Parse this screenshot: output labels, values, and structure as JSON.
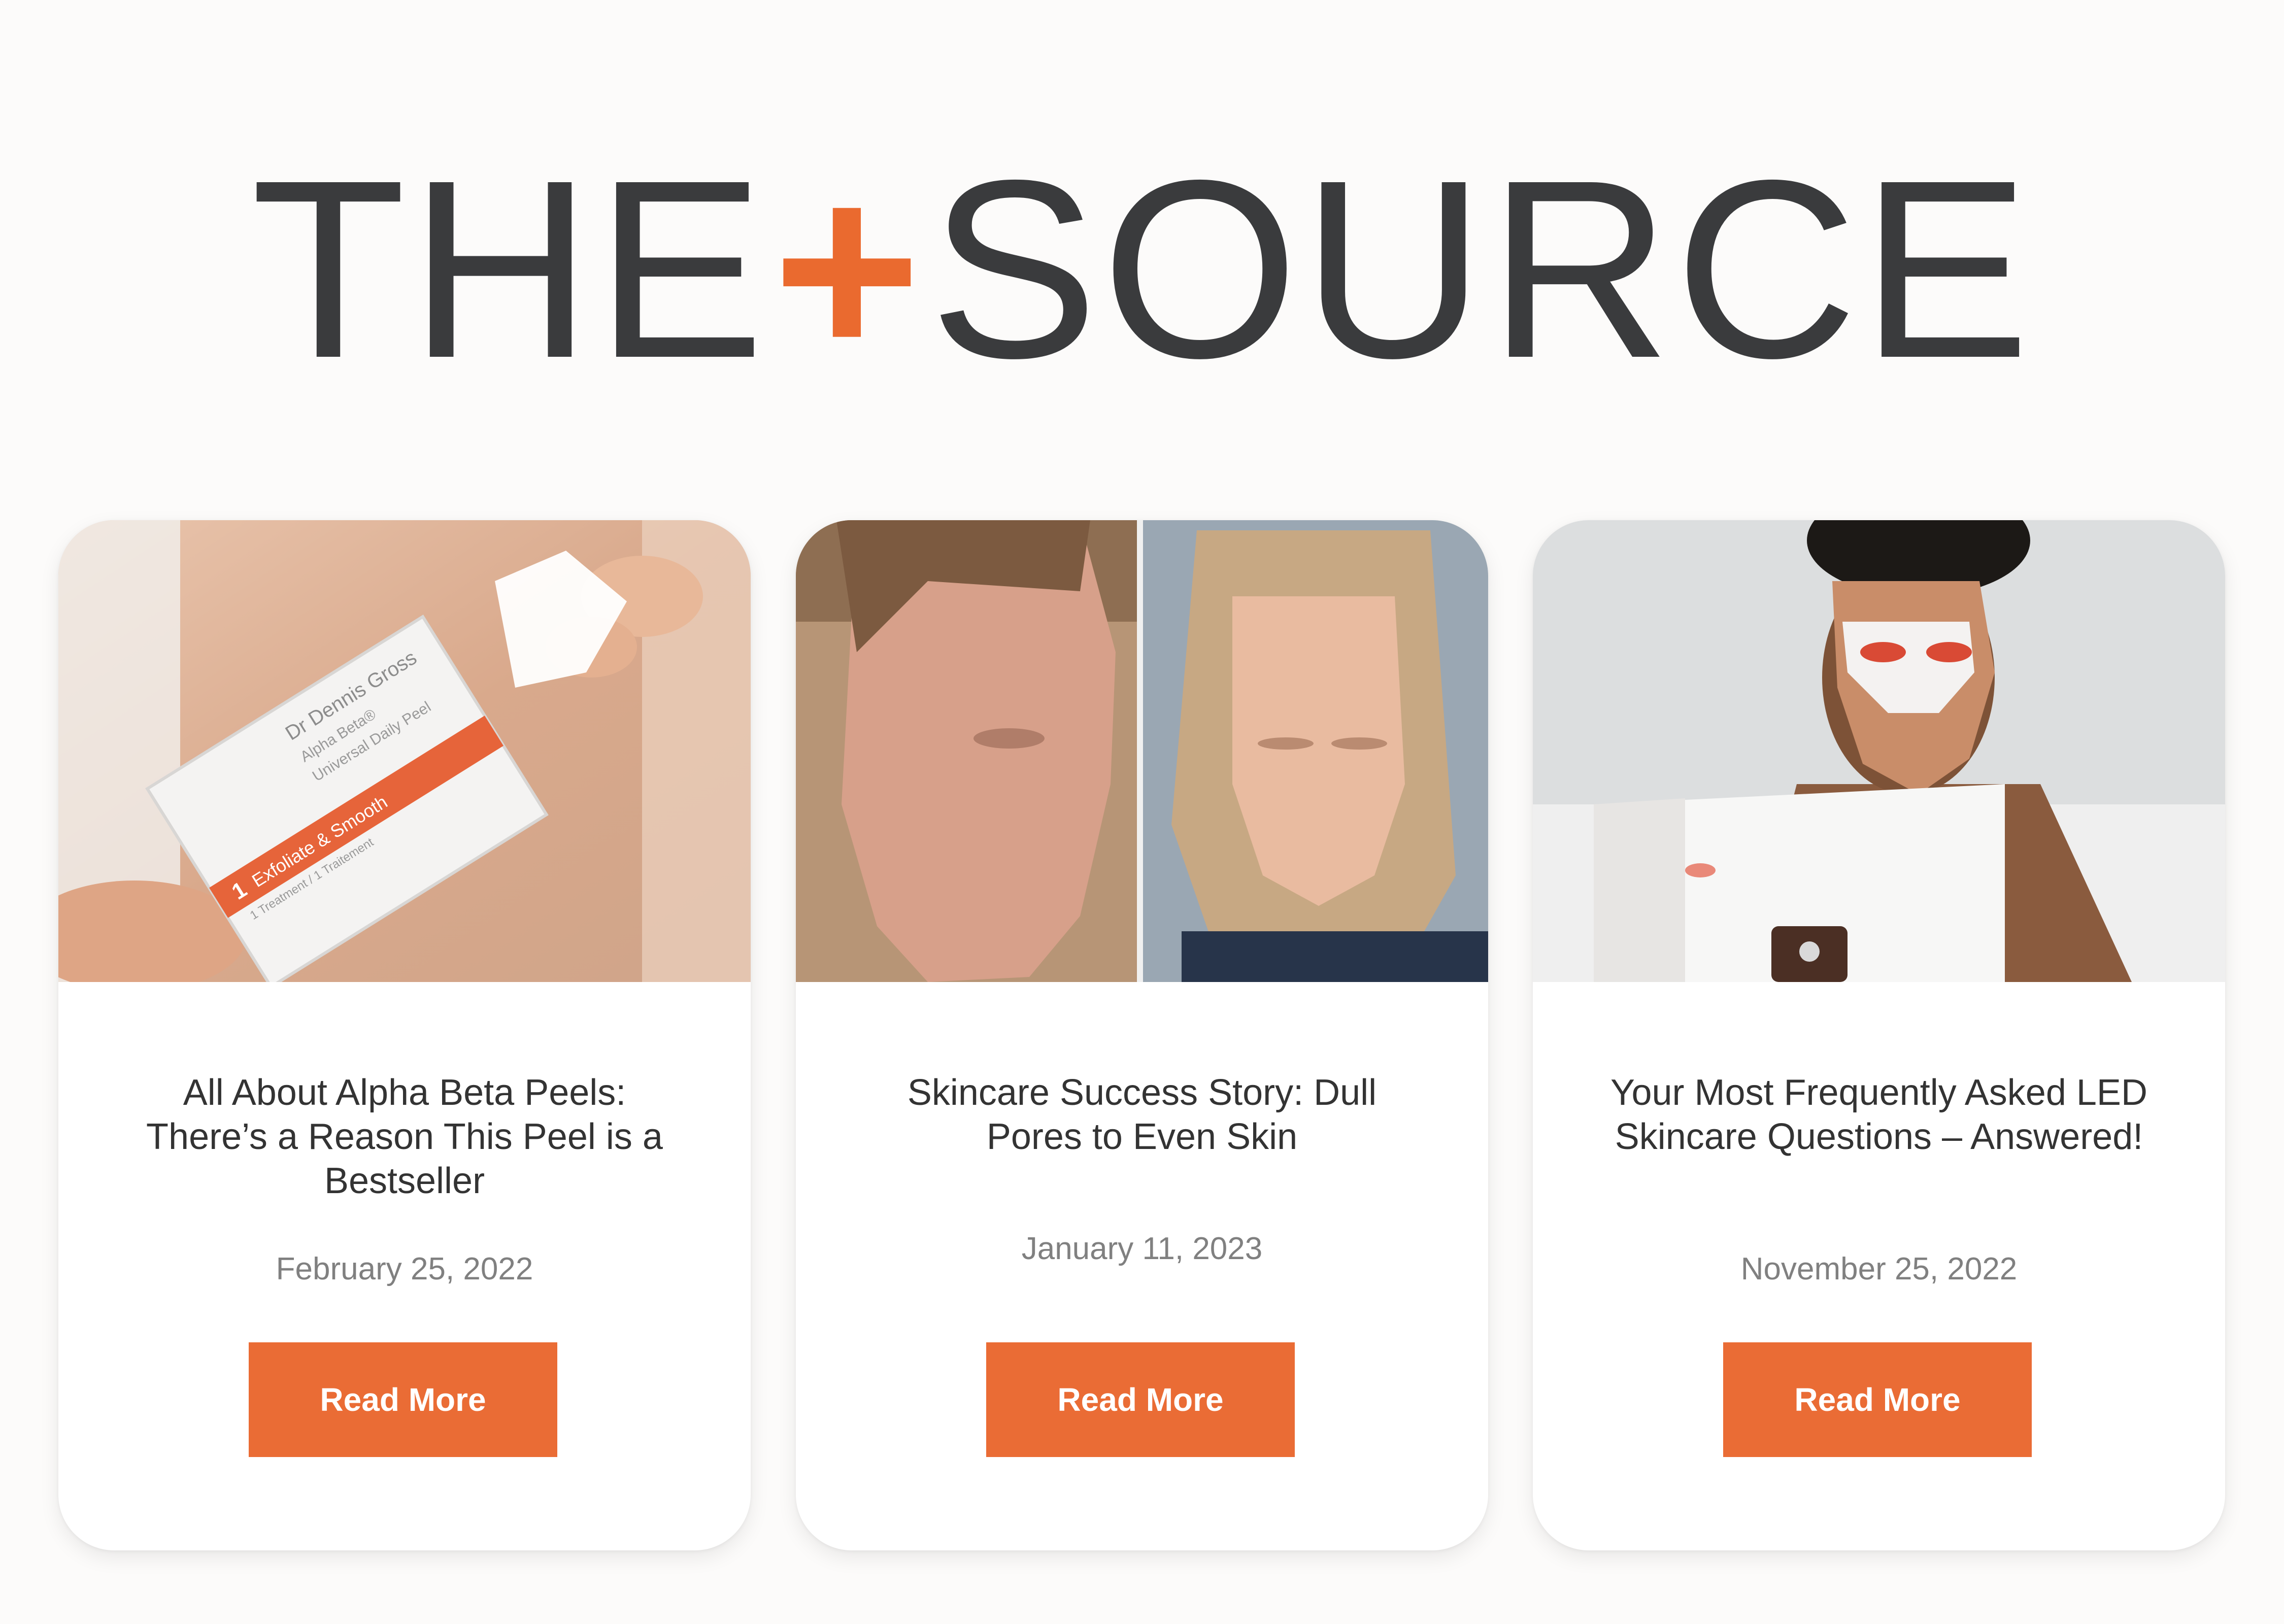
{
  "brand": {
    "logo_left": "THE",
    "logo_plus": "+",
    "logo_right": "SOURCE",
    "accent": "#ea6a2f"
  },
  "cards": [
    {
      "title": "All About Alpha Beta Peels: There’s a Reason This Peel is a Bestseller",
      "date": "February 25, 2022",
      "button": "Read More",
      "image_text": {
        "brand": "Dr Dennis Gross",
        "product": "Alpha Beta®",
        "subtitle": "Universal Daily Peel",
        "step_number": "1",
        "step": "Exfoliate & Smooth",
        "treatment": "1 Treatment / 1 Traitement"
      }
    },
    {
      "title": "Skincare Success Story: Dull Pores to Even Skin",
      "date": "January 11, 2023",
      "button": "Read More"
    },
    {
      "title": "Your Most Frequently Asked LED Skincare Questions – Answered!",
      "date": "November 25, 2022",
      "button": "Read More"
    }
  ]
}
